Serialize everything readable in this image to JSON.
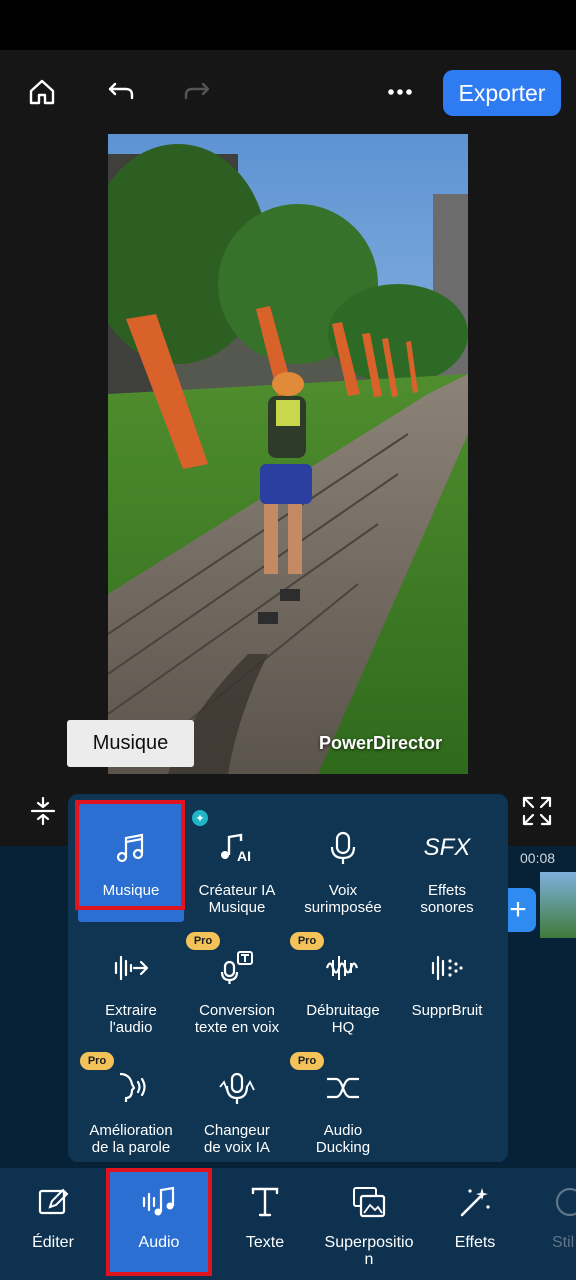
{
  "toolbar": {
    "export_label": "Exporter",
    "icons": [
      "home-icon",
      "undo-icon",
      "redo-icon",
      "more-icon"
    ]
  },
  "preview": {
    "watermark": "PowerDirector"
  },
  "tooltip": {
    "text": "Musique"
  },
  "timeline": {
    "time_label": "00:08"
  },
  "audio_menu": {
    "items": [
      {
        "label": "Musique",
        "icon": "music-note-icon",
        "pro": false,
        "selected": true
      },
      {
        "label": "Créateur IA\nMusique",
        "icon": "ai-music-icon",
        "pro": false,
        "badge": "new"
      },
      {
        "label": "Voix\nsurimposée",
        "icon": "microphone-icon",
        "pro": false
      },
      {
        "label": "Effets\nsonores",
        "icon": "sfx-icon",
        "pro": false
      },
      {
        "label": "Extraire\nl'audio",
        "icon": "extract-audio-icon",
        "pro": false
      },
      {
        "label": "Conversion\ntexte en voix",
        "icon": "text-to-speech-icon",
        "pro": true
      },
      {
        "label": "Débruitage\nHQ",
        "icon": "denoise-icon",
        "pro": true
      },
      {
        "label": "SupprBruit",
        "icon": "noise-remove-icon",
        "pro": false
      },
      {
        "label": "Amélioration\nde la parole",
        "icon": "speech-enhance-icon",
        "pro": true
      },
      {
        "label": "Changeur\nde voix IA",
        "icon": "voice-changer-icon",
        "pro": false
      },
      {
        "label": "Audio\nDucking",
        "icon": "audio-ducking-icon",
        "pro": true
      }
    ],
    "pro_label": "Pro",
    "sfx_glyph": "SFX"
  },
  "bottom_nav": {
    "items": [
      {
        "label": "Éditer",
        "icon": "edit-icon"
      },
      {
        "label": "Audio",
        "icon": "audio-icon",
        "selected": true
      },
      {
        "label": "Texte",
        "icon": "text-icon"
      },
      {
        "label": "Superpositio\nn",
        "icon": "overlay-icon"
      },
      {
        "label": "Effets",
        "icon": "effects-icon"
      },
      {
        "label": "Stil",
        "icon": "sticker-icon"
      }
    ]
  },
  "colors": {
    "accent": "#2f7cf2",
    "menu_bg": "#0f3552",
    "selected": "#2a6fd1",
    "highlight": "#e0141f",
    "pro_badge": "#f3c35a"
  }
}
